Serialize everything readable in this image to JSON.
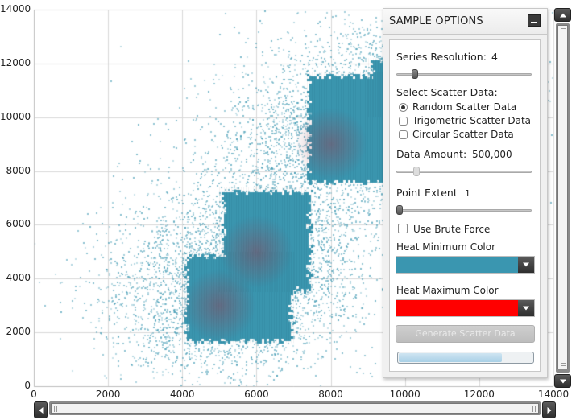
{
  "chart_data": {
    "type": "heatmap",
    "title": "",
    "xlabel": "",
    "ylabel": "",
    "xlim": [
      0,
      14000
    ],
    "ylim": [
      0,
      14000
    ],
    "x_ticks": [
      "0",
      "2000",
      "4000",
      "6000",
      "8000",
      "10000",
      "12000",
      "14000"
    ],
    "y_ticks": [
      "0",
      "2000",
      "4000",
      "6000",
      "8000",
      "10000",
      "12000",
      "14000"
    ],
    "grid": true,
    "heat_min_color": "#3a96b0",
    "heat_max_color": "#ff0000",
    "point_color": "#3a96b0",
    "clusters": [
      {
        "cx": 5000,
        "cy": 3000,
        "spread": 1400,
        "weight": 0.25
      },
      {
        "cx": 6000,
        "cy": 5000,
        "spread": 1500,
        "weight": 0.25
      },
      {
        "cx": 8000,
        "cy": 9000,
        "spread": 1500,
        "weight": 0.25
      },
      {
        "cx": 10000,
        "cy": 11000,
        "spread": 1500,
        "weight": 0.25
      }
    ],
    "dense_regions": [
      {
        "x0": 4000,
        "x1": 7000,
        "y0": 1600,
        "y1": 5000
      },
      {
        "x0": 5000,
        "x1": 7500,
        "y0": 3500,
        "y1": 7400
      },
      {
        "x0": 7300,
        "x1": 10000,
        "y0": 7500,
        "y1": 11700
      },
      {
        "x0": 9000,
        "x1": 10000,
        "y0": 10000,
        "y1": 12200
      }
    ],
    "hot_spots": [
      {
        "x": 6000,
        "y": 5000
      },
      {
        "x": 5000,
        "y": 3000
      },
      {
        "x": 8000,
        "y": 9000
      }
    ],
    "total_points": 500000
  },
  "panel": {
    "title": "SAMPLE OPTIONS",
    "series_resolution_label": "Series Resolution:",
    "series_resolution_value": "4",
    "series_resolution_fraction": 0.12,
    "select_scatter_label": "Select Scatter Data:",
    "scatter_options": [
      {
        "label": "Random Scatter Data",
        "selected": true
      },
      {
        "label": "Trigometric Scatter Data",
        "selected": false
      },
      {
        "label": "Circular Scatter Data",
        "selected": false
      }
    ],
    "data_amount_label": "Data Amount:",
    "data_amount_value": "500,000",
    "data_amount_fraction": 0.13,
    "point_extent_label": "Point Extent",
    "point_extent_value": "1",
    "point_extent_fraction": 0.0,
    "brute_force_label": "Use Brute Force",
    "brute_force_checked": false,
    "heat_min_label": "Heat Minimum Color",
    "heat_min_color": "#3a96b0",
    "heat_max_label": "Heat Maximum Color",
    "heat_max_color": "#ff0000",
    "generate_label": "Generate Scatter Data",
    "progress_fraction": 0.76
  },
  "scrollbars": {
    "vertical_thumb": "full",
    "horizontal_thumb": "full"
  }
}
